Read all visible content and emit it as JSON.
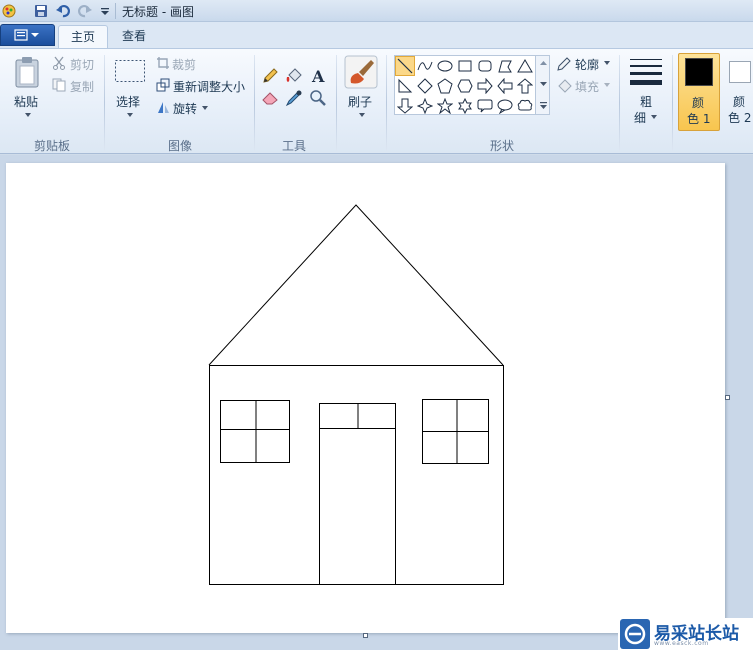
{
  "window": {
    "title": "无标题 - 画图"
  },
  "tabs": [
    {
      "label": "主页"
    },
    {
      "label": "查看"
    }
  ],
  "clipboard": {
    "paste": "粘贴",
    "cut": "剪切",
    "copy": "复制",
    "group": "剪贴板"
  },
  "image": {
    "select": "选择",
    "crop": "裁剪",
    "resize": "重新调整大小",
    "rotate": "旋转",
    "group": "图像"
  },
  "tools": {
    "group": "工具",
    "brush": "刷子"
  },
  "shapes": {
    "group": "形状",
    "outline": "轮廓",
    "fill": "填充"
  },
  "size": {
    "label_top": "粗",
    "label_bottom": "细"
  },
  "colors": {
    "color1_top": "颜",
    "color1_bottom": "色 1",
    "color1_value": "#000000",
    "color2_top": "颜",
    "color2_bottom": "色 2",
    "color2_value": "#ffffff"
  },
  "watermark": {
    "name": "易采站长站",
    "url": "www.easck.com"
  }
}
